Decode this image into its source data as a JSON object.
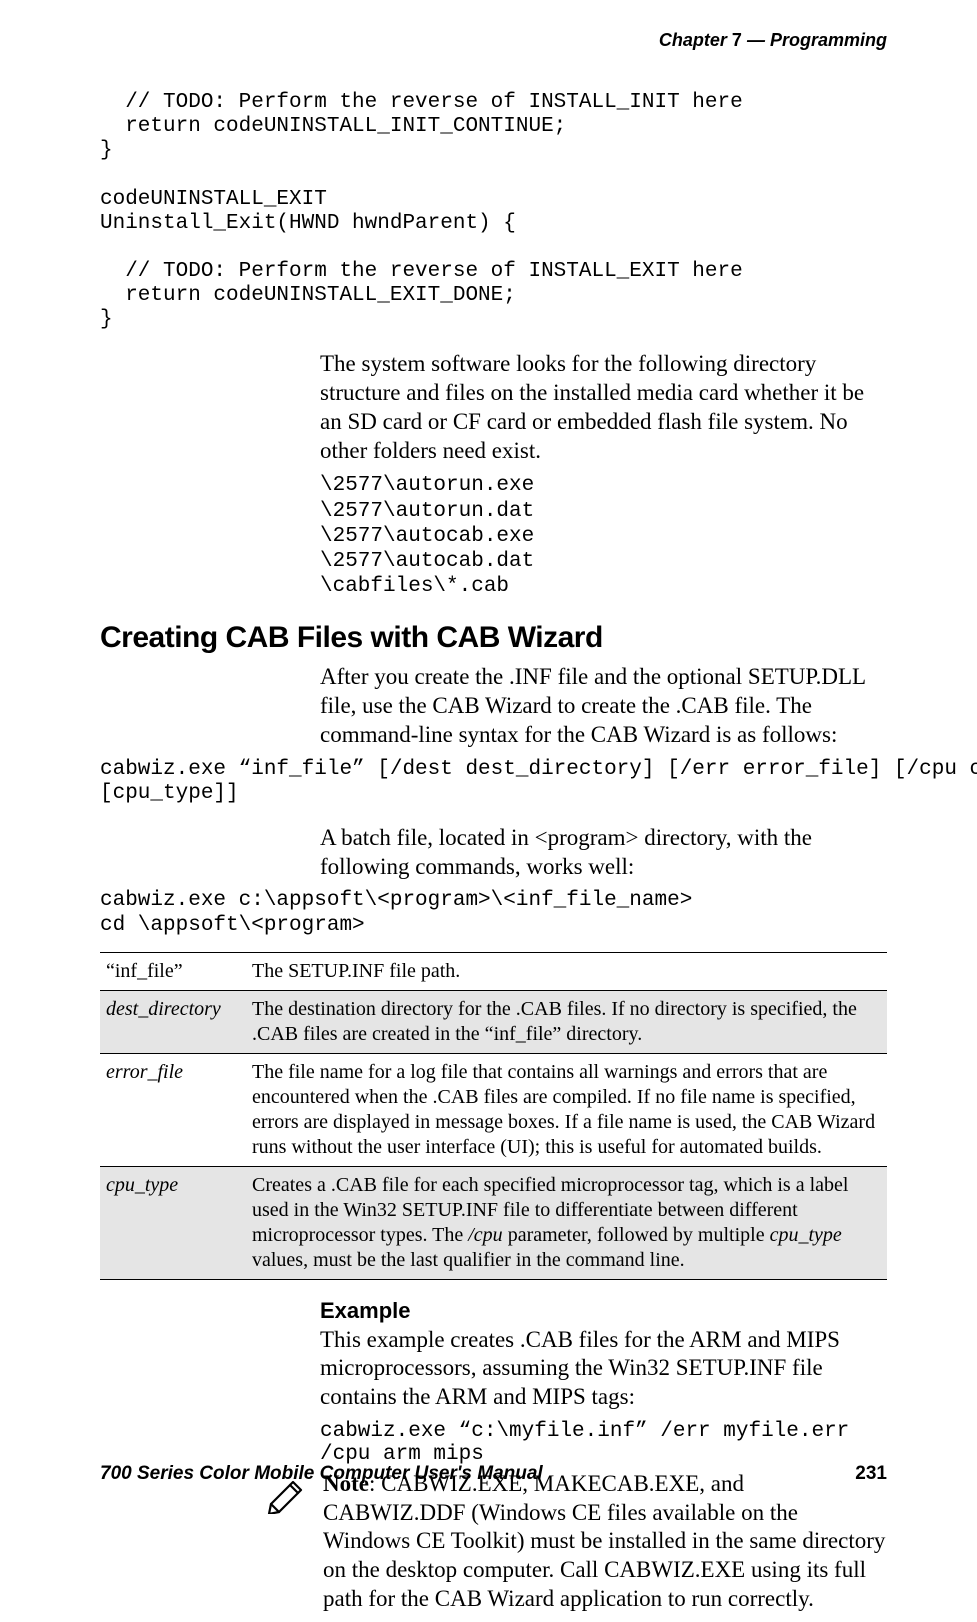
{
  "header": {
    "left": "Chapter",
    "num": "7",
    "dash": "—",
    "right": "Programming"
  },
  "code_block_1": "  // TODO: Perform the reverse of INSTALL_INIT here\n  return codeUNINSTALL_INIT_CONTINUE;\n}\n\ncodeUNINSTALL_EXIT\nUninstall_Exit(HWND hwndParent) {\n\n  // TODO: Perform the reverse of INSTALL_EXIT here\n  return codeUNINSTALL_EXIT_DONE;\n}",
  "para1": "The system software looks for the following directory structure and files on the installed media card whether it be an SD card or CF card or embedded flash file system. No other folders need exist.",
  "paths": "\\2577\\autorun.exe\n\\2577\\autorun.dat\n\\2577\\autocab.exe\n\\2577\\autocab.dat\n\\cabfiles\\*.cab",
  "section_heading": "Creating CAB Files with CAB Wizard",
  "para2": "After you create the .INF file and the optional SETUP.DLL file, use the CAB Wizard to create the .CAB file. The command-line syntax for the CAB Wizard is as follows:",
  "syntax": "cabwiz.exe “inf_file” [/dest dest_directory] [/err error_file] [/cpu cpu_type\n[cpu_type]]",
  "para3": "A batch file, located in <program> directory, with the following commands, works well:",
  "batch": "cabwiz.exe c:\\appsoft\\<program>\\<inf_file_name>\ncd \\appsoft\\<program>",
  "table": {
    "rows": [
      {
        "key": "“inf_file”",
        "key_is_quoted": true,
        "desc": "The SETUP.INF file path."
      },
      {
        "key": "dest_directory",
        "desc": "The destination directory for the .CAB files. If no directory is specified, the .CAB files are created in the “inf_file” directory."
      },
      {
        "key": "error_file",
        "desc": "The file name for a log file that contains all warnings and errors that are encountered when the .CAB files are compiled. If no file name is specified, errors are displayed in message boxes. If a file name is used, the CAB Wizard runs without the user interface (UI); this is useful for automated builds."
      },
      {
        "key": "cpu_type",
        "desc_html": true,
        "desc": "Creates a .CAB file for each specified microprocessor tag, which is a label used in the Win32 SETUP.INF file to differentiate between different microprocessor types. The <span class='italic'>/cpu</span> parameter, followed by multiple <span class='italic'>cpu_type</span> values, must be the last qualifier in the command line."
      }
    ]
  },
  "example_heading": "Example",
  "example_para": "This example creates .CAB files for the ARM and MIPS microprocessors, assuming the Win32 SETUP.INF file contains the ARM and MIPS tags:",
  "example_cmd": "cabwiz.exe “c:\\myfile.inf” /err myfile.err /cpu arm mips",
  "note_label": "Note",
  "note_body": ": CABWIZ.EXE, MAKECAB.EXE, and CABWIZ.DDF (Windows CE files available on the Windows CE Toolkit) must be installed in the same directory on the desktop computer. Call CABWIZ.EXE using its full path for the CAB Wizard application to run correctly.",
  "footer": {
    "title": "700 Series Color Mobile Computer User's Manual",
    "page": "231"
  }
}
